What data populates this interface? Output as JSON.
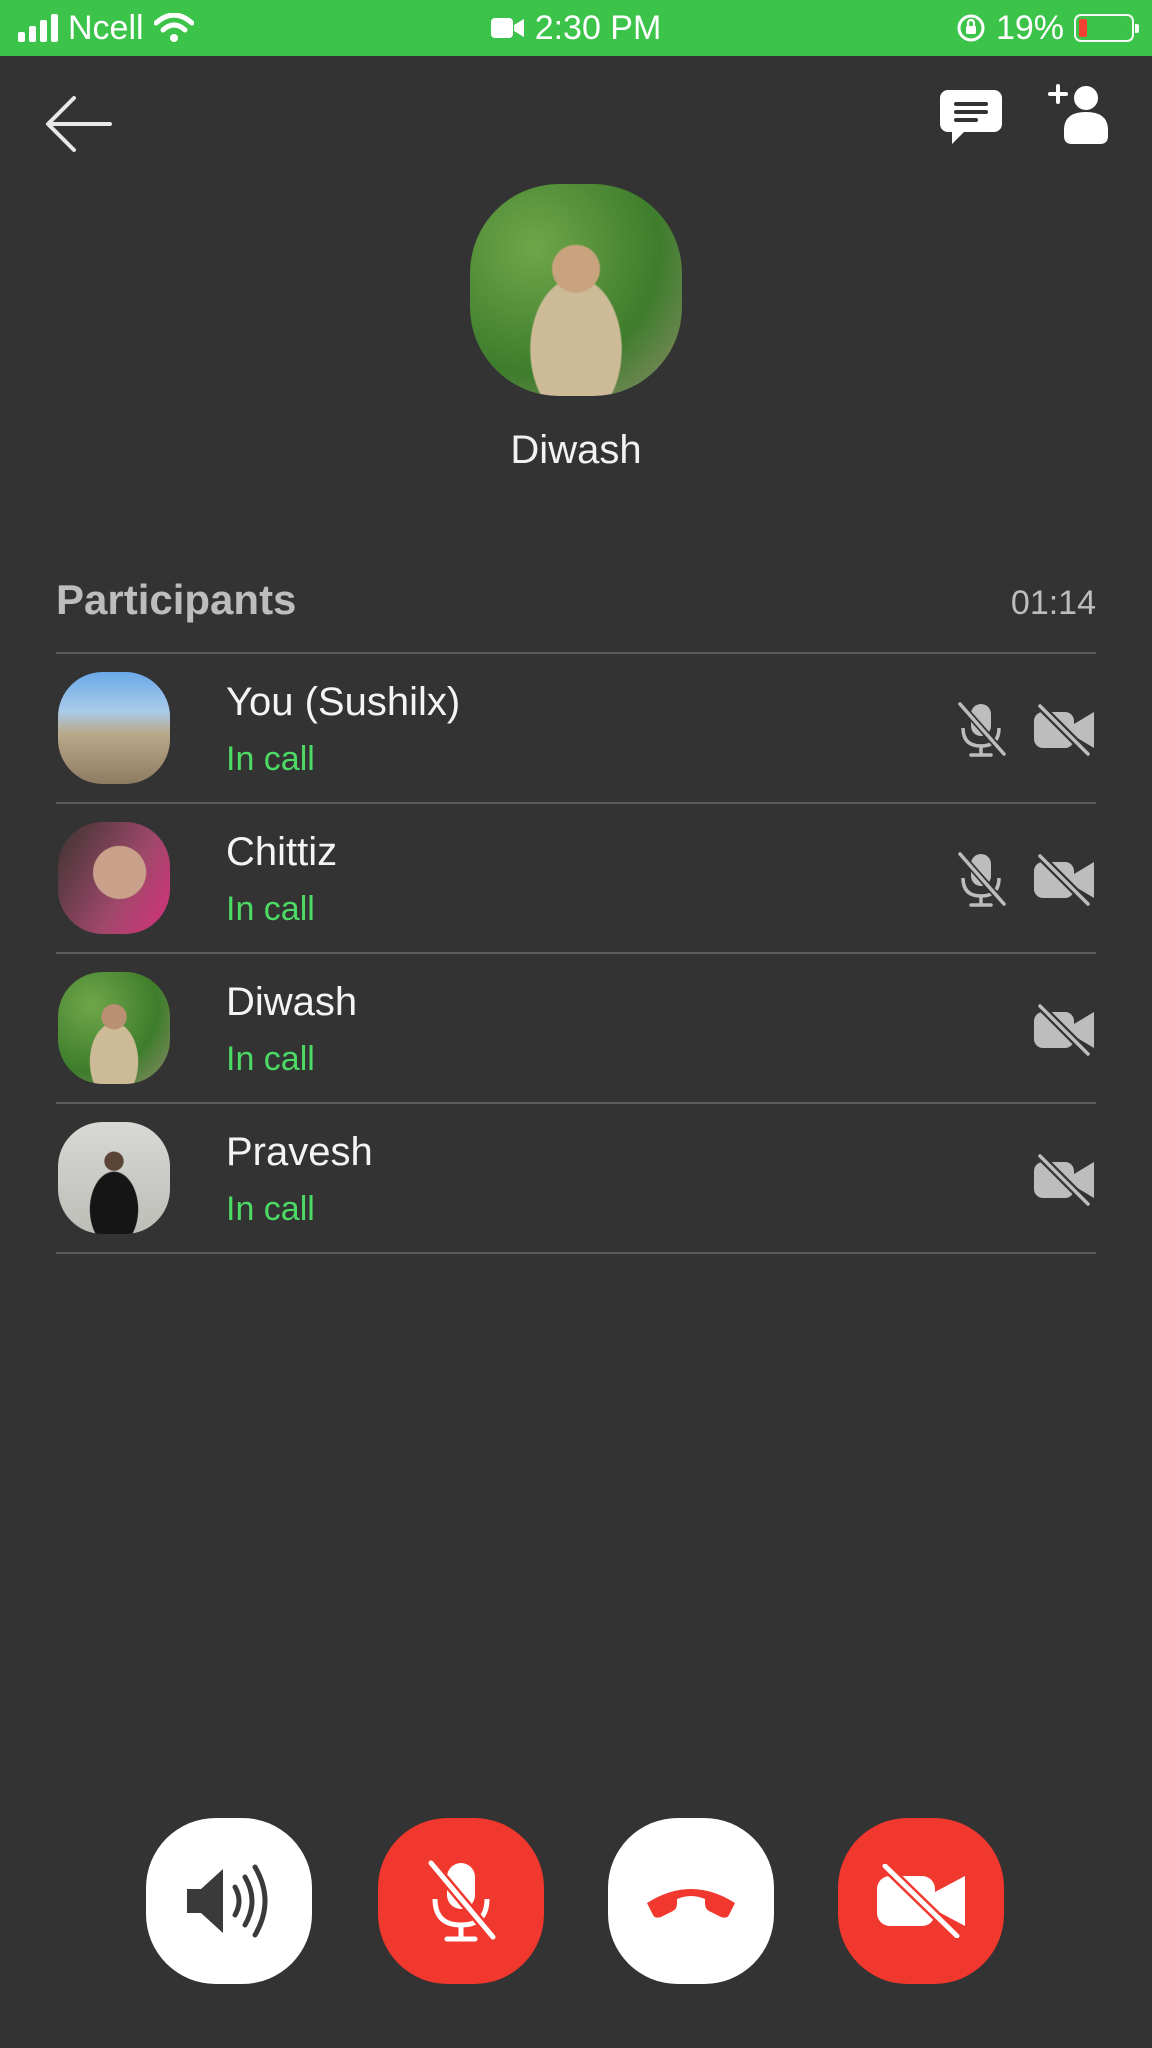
{
  "status_bar": {
    "carrier": "Ncell",
    "time": "2:30 PM",
    "battery_percent": "19%",
    "battery_level": 0.19,
    "icons": [
      "signal-icon",
      "wifi-icon",
      "video-recording-icon",
      "orientation-lock-icon",
      "battery-icon"
    ],
    "background_color": "#3cc34a"
  },
  "top_bar": {
    "icons": [
      "back-arrow-icon",
      "chat-icon",
      "add-person-icon"
    ]
  },
  "caller": {
    "name": "Diwash"
  },
  "participants": {
    "title": "Participants",
    "timer": "01:14",
    "items": [
      {
        "name": "You (Sushilx)",
        "status": "In call",
        "mic_muted": true,
        "video_off": true
      },
      {
        "name": "Chittiz",
        "status": "In call",
        "mic_muted": true,
        "video_off": true
      },
      {
        "name": "Diwash",
        "status": "In call",
        "mic_muted": false,
        "video_off": true
      },
      {
        "name": "Pravesh",
        "status": "In call",
        "mic_muted": false,
        "video_off": true
      }
    ]
  },
  "controls": {
    "buttons": [
      "speaker-icon",
      "mic-off-icon",
      "end-call-icon",
      "video-off-icon"
    ],
    "active_color": "#f1382e",
    "end_call_icon_color": "#f1382e"
  },
  "colors": {
    "background": "#333333",
    "in_call_status": "#4cd964"
  }
}
